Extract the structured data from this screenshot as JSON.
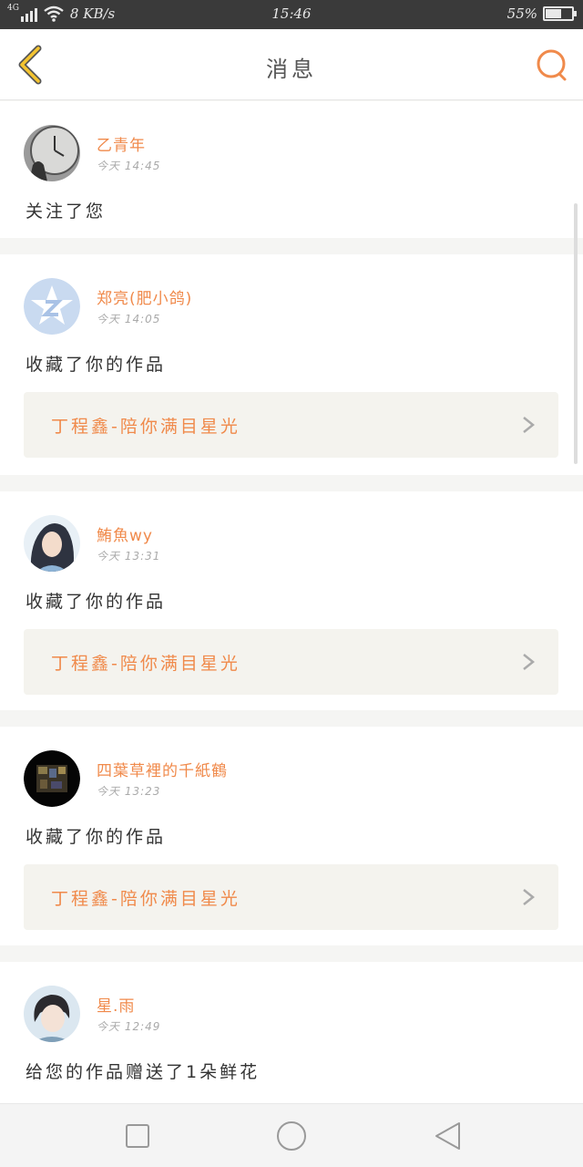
{
  "status_bar": {
    "network_type": "4G",
    "speed": "8 KB/s",
    "time": "15:46",
    "battery": "55%",
    "icons": [
      "signal-icon",
      "wifi-icon",
      "battery-icon"
    ]
  },
  "header": {
    "title": "消息",
    "back_icon": "chevron-left-icon",
    "search_icon": "search-icon"
  },
  "colors": {
    "accent": "#f08a4b",
    "back_accent": "#f4c430",
    "card_bg": "#ffffff",
    "link_bg": "#f4f3ee"
  },
  "notifications": [
    {
      "username": "乙青年",
      "time": "今天 14:45",
      "message": "关注了您",
      "work_title": "",
      "avatar": "clock-photo"
    },
    {
      "username": "郑亮(肥小鸽)",
      "time": "今天 14:05",
      "message": "收藏了你的作品",
      "work_title": "丁程鑫-陪你满目星光",
      "avatar": "qzone-logo"
    },
    {
      "username": "鮪魚wy",
      "time": "今天 13:31",
      "message": "收藏了你的作品",
      "work_title": "丁程鑫-陪你满目星光",
      "avatar": "girl-photo"
    },
    {
      "username": "四葉草裡的千紙鶴",
      "time": "今天 13:23",
      "message": "收藏了你的作品",
      "work_title": "丁程鑫-陪你满目星光",
      "avatar": "dark-photo"
    },
    {
      "username": "星.雨",
      "time": "今天 12:49",
      "message": "给您的作品赠送了1朵鲜花",
      "work_title": "",
      "avatar": "boy-photo"
    }
  ],
  "nav": {
    "icons": [
      "recent-apps-icon",
      "home-icon",
      "back-icon"
    ]
  }
}
